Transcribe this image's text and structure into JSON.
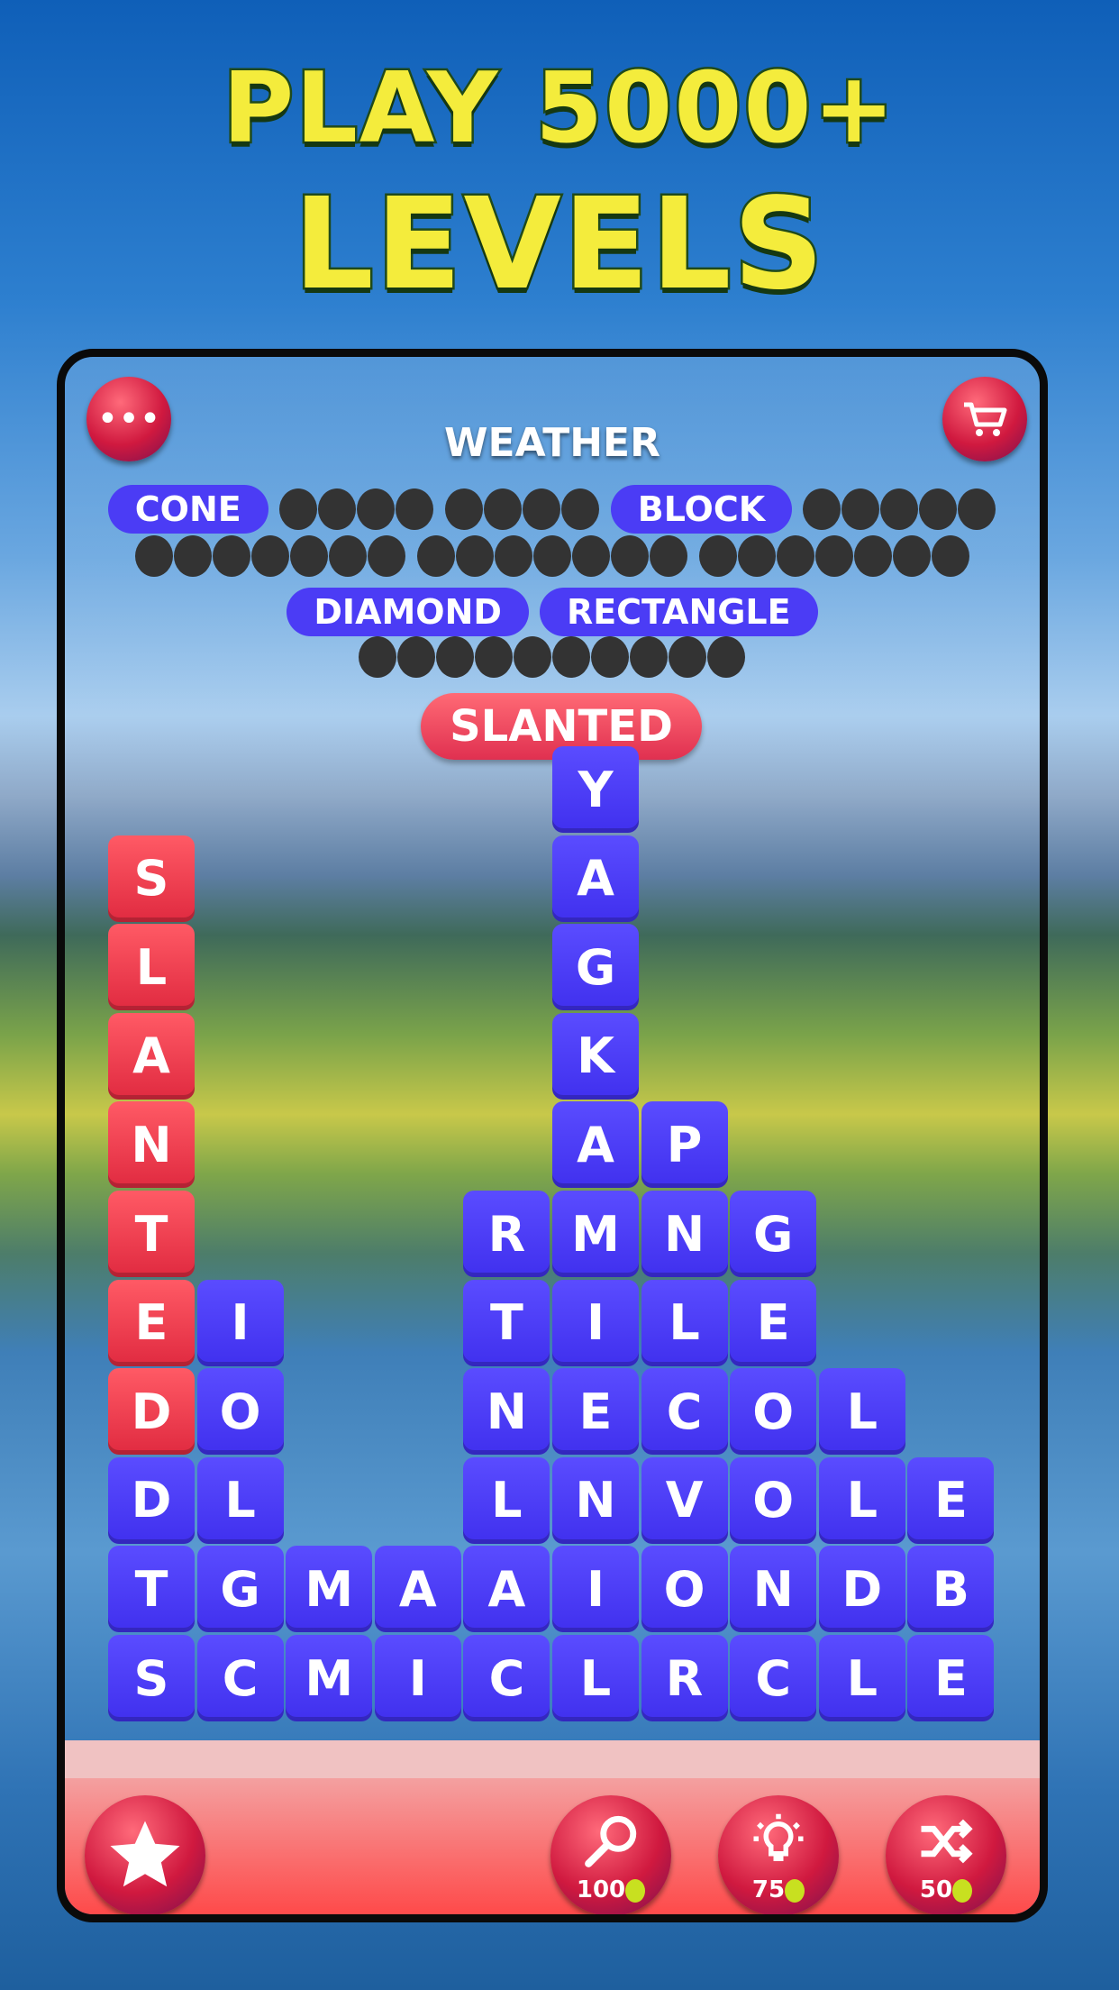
{
  "promo": {
    "line1": "PLAY 5000+",
    "line2": "LEVELS"
  },
  "header": {
    "category": "WEATHER",
    "menu_icon": "ellipsis-icon",
    "shop_icon": "cart-icon"
  },
  "hints": [
    [
      {
        "found": true,
        "word": "CONE"
      },
      {
        "found": false,
        "length": 4
      },
      {
        "found": false,
        "length": 4
      },
      {
        "found": true,
        "word": "BLOCK"
      },
      {
        "found": false,
        "length": 5
      }
    ],
    [
      {
        "found": false,
        "length": 7
      },
      {
        "found": false,
        "length": 7
      },
      {
        "found": false,
        "length": 7
      }
    ],
    [
      {
        "found": true,
        "word": "DIAMOND"
      },
      {
        "found": true,
        "word": "RECTANGLE"
      }
    ],
    [
      {
        "found": false,
        "length": 10
      }
    ]
  ],
  "current_word": "SLANTED",
  "grid": {
    "columns": [
      {
        "letters": [
          "S",
          "L",
          "A",
          "N",
          "T",
          "E",
          "D",
          "D",
          "T",
          "S"
        ],
        "selected": 7
      },
      {
        "letters": [
          "I",
          "O",
          "L",
          "G",
          "C"
        ],
        "selected": 0
      },
      {
        "letters": [
          "M",
          "M"
        ],
        "selected": 0
      },
      {
        "letters": [
          "A",
          "I"
        ],
        "selected": 0
      },
      {
        "letters": [
          "R",
          "T",
          "N",
          "L",
          "A",
          "C"
        ],
        "selected": 0
      },
      {
        "letters": [
          "Y",
          "A",
          "G",
          "K",
          "A",
          "M",
          "I",
          "E",
          "N",
          "I",
          "L"
        ],
        "selected": 0
      },
      {
        "letters": [
          "P",
          "N",
          "L",
          "C",
          "V",
          "O",
          "R"
        ],
        "selected": 0
      },
      {
        "letters": [
          "G",
          "E",
          "O",
          "O",
          "N",
          "C"
        ],
        "selected": 0
      },
      {
        "letters": [
          "L",
          "L",
          "D",
          "L"
        ],
        "selected": 0
      },
      {
        "letters": [
          "E",
          "B",
          "E"
        ],
        "selected": 0
      }
    ]
  },
  "colors": {
    "tile": "#4b3cf5",
    "selected_tile": "#f0404f",
    "title": "#f4ec3c"
  },
  "toolbar": {
    "favorite": {
      "icon": "star-icon"
    },
    "powerups": [
      {
        "name": "magnifier",
        "icon": "magnifier-icon",
        "cost": "100"
      },
      {
        "name": "hint",
        "icon": "lightbulb-icon",
        "cost": "75"
      },
      {
        "name": "shuffle",
        "icon": "shuffle-icon",
        "cost": "50"
      }
    ]
  }
}
